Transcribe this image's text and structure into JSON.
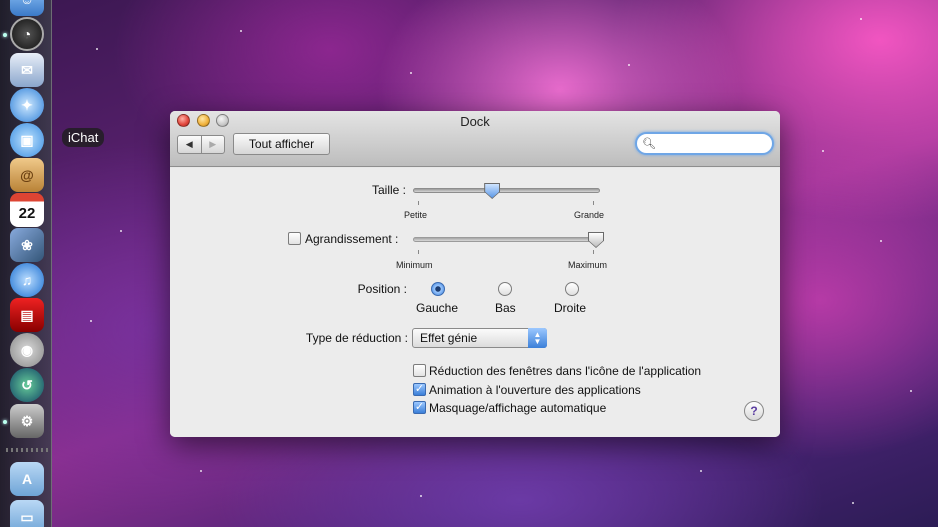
{
  "window": {
    "title": "Dock",
    "show_all": "Tout afficher",
    "search_placeholder": ""
  },
  "dock": {
    "hover_label": "iChat",
    "calendar_day": "22",
    "icons": [
      "finder-icon",
      "dashboard-icon",
      "mail-icon",
      "safari-icon",
      "ichat-icon",
      "address-book-icon",
      "ical-icon",
      "iphoto-icon",
      "itunes-icon",
      "photo-booth-icon",
      "dvd-player-icon",
      "time-machine-icon",
      "system-preferences-icon",
      "applications-folder-icon",
      "documents-folder-icon"
    ]
  },
  "size": {
    "label": "Taille :",
    "min": "Petite",
    "max": "Grande",
    "value": 0.42
  },
  "magnification": {
    "label": "Agrandissement :",
    "checked": false,
    "min": "Minimum",
    "max": "Maximum",
    "value": 1.0
  },
  "position": {
    "label": "Position :",
    "options": [
      "Gauche",
      "Bas",
      "Droite"
    ],
    "selected": "Gauche"
  },
  "minimize": {
    "label": "Type de réduction :",
    "value": "Effet génie"
  },
  "options": [
    {
      "label": "Réduction des fenêtres dans l'icône de l'application",
      "checked": false
    },
    {
      "label": "Animation à l'ouverture des applications",
      "checked": true
    },
    {
      "label": "Masquage/affichage automatique",
      "checked": true
    }
  ],
  "help": "?",
  "colors": {
    "accent": "#3b7fd8",
    "search_glow": "#6fa6e6"
  }
}
